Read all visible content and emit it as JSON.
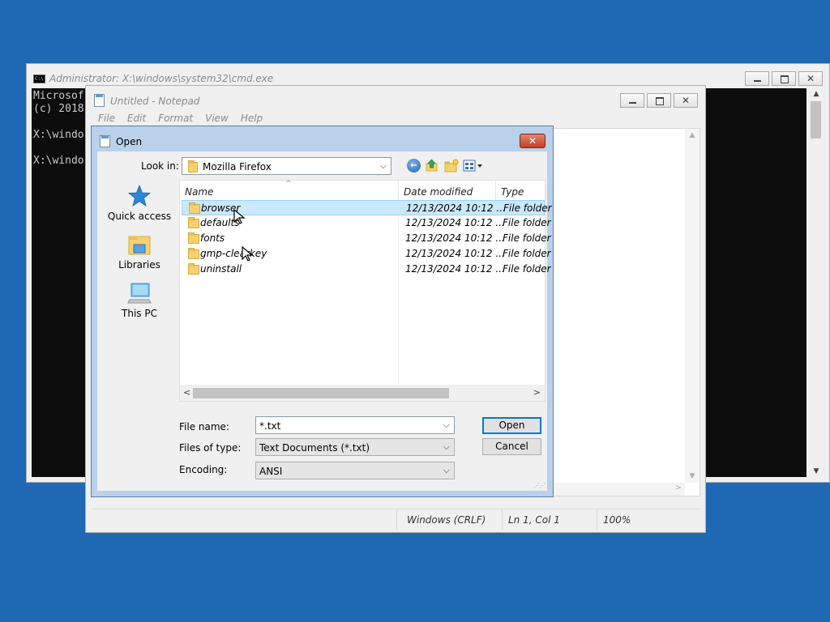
{
  "cmd": {
    "title": "Administrator: X:\\windows\\system32\\cmd.exe",
    "lines": [
      "Microsof",
      "(c) 2018",
      "",
      "X:\\windo",
      "",
      "X:\\windo"
    ]
  },
  "notepad": {
    "title": "Untitled - Notepad",
    "menu": [
      "File",
      "Edit",
      "Format",
      "View",
      "Help"
    ],
    "status": {
      "line_ending": "Windows (CRLF)",
      "position": "Ln 1, Col 1",
      "zoom": "100%"
    }
  },
  "dialog": {
    "title": "Open",
    "look_in_label": "Look in:",
    "look_in_value": "Mozilla Firefox",
    "places": [
      {
        "label": "Quick access",
        "icon": "quick-access-star-icon"
      },
      {
        "label": "Libraries",
        "icon": "libraries-icon"
      },
      {
        "label": "This PC",
        "icon": "this-pc-icon"
      }
    ],
    "columns": [
      "Name",
      "Date modified",
      "Type"
    ],
    "files": [
      {
        "name": "browser",
        "date": "12/13/2024 10:12 ...",
        "type": "File folder"
      },
      {
        "name": "defaults",
        "date": "12/13/2024 10:12 ...",
        "type": "File folder"
      },
      {
        "name": "fonts",
        "date": "12/13/2024 10:12 ...",
        "type": "File folder"
      },
      {
        "name": "gmp-clearkey",
        "date": "12/13/2024 10:12 ...",
        "type": "File folder"
      },
      {
        "name": "uninstall",
        "date": "12/13/2024 10:12 ...",
        "type": "File folder"
      }
    ],
    "file_name_label": "File name:",
    "file_name_value": "*.txt",
    "files_of_type_label": "Files of type:",
    "files_of_type_value": "Text Documents (*.txt)",
    "encoding_label": "Encoding:",
    "encoding_value": "ANSI",
    "open_button": "Open",
    "cancel_button": "Cancel"
  },
  "colors": {
    "desktop": "#1e68b4",
    "selection": "#cce8ff",
    "accent": "#0078d7",
    "close_red": "#c43e23"
  }
}
